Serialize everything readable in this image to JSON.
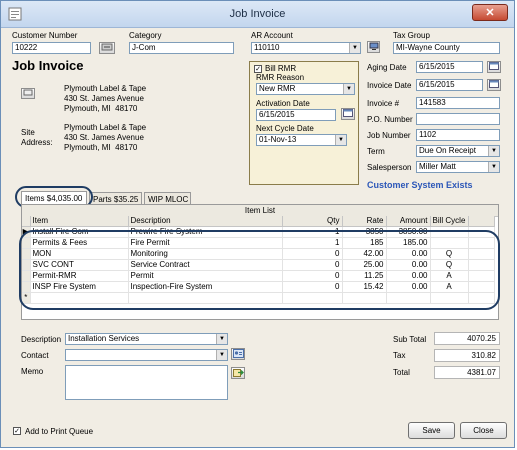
{
  "window": {
    "title": "Job Invoice"
  },
  "top": {
    "customer_number_label": "Customer Number",
    "customer_number": "10222",
    "category_label": "Category",
    "category": "J-Com",
    "ar_account_label": "AR Account",
    "ar_account": "110110",
    "tax_group_label": "Tax Group",
    "tax_group": "MI-Wayne County"
  },
  "heading": "Job Invoice",
  "bill_to": {
    "name": "Plymouth Label & Tape",
    "street": "430 St. James Avenue",
    "city": "Plymouth, MI  48170"
  },
  "site": {
    "label": "Site Address:",
    "name": "Plymouth Label & Tape",
    "street": "430 St. James Avenue",
    "city": "Plymouth, MI  48170"
  },
  "rmr": {
    "bill_rmr_label": "Bill RMR",
    "bill_rmr_checked": true,
    "reason_label": "RMR Reason",
    "reason": "New RMR",
    "activation_label": "Activation Date",
    "activation": "6/15/2015",
    "next_cycle_label": "Next Cycle Date",
    "next_cycle": "01-Nov-13"
  },
  "invoice": {
    "aging_label": "Aging Date",
    "aging": "6/15/2015",
    "invoice_date_label": "Invoice Date",
    "invoice_date": "6/15/2015",
    "invoice_no_label": "Invoice #",
    "invoice_no": "141583",
    "po_label": "P.O. Number",
    "po": "",
    "job_label": "Job Number",
    "job": "1102",
    "term_label": "Term",
    "term": "Due On Receipt",
    "salesperson_label": "Salesperson",
    "salesperson": "Miller Matt"
  },
  "customer_system_link": "Customer System Exists",
  "tabs": [
    {
      "label": "Items  $4,035.00"
    },
    {
      "label": "Parts  $35.25"
    },
    {
      "label": "WIP MLOC"
    }
  ],
  "grid": {
    "caption": "Item List",
    "columns": [
      "Item",
      "Description",
      "Qty",
      "Rate",
      "Amount",
      "Bill Cycle"
    ],
    "rows": [
      [
        "Install Fire Com",
        "Prewire Fire System",
        "1",
        "3850",
        "3850.00",
        ""
      ],
      [
        "Permits & Fees",
        "Fire Permit",
        "1",
        "185",
        "185.00",
        ""
      ],
      [
        "MON",
        "Monitoring",
        "0",
        "42.00",
        "0.00",
        "Q"
      ],
      [
        "SVC CONT",
        "Service Contract",
        "0",
        "25.00",
        "0.00",
        "Q"
      ],
      [
        "Permit-RMR",
        "Permit",
        "0",
        "11.25",
        "0.00",
        "A"
      ],
      [
        "INSP Fire System",
        "Inspection-Fire System",
        "0",
        "15.42",
        "0.00",
        "A"
      ],
      [
        "",
        "",
        "",
        "",
        "",
        ""
      ]
    ],
    "new_row_marker": "*",
    "current_row_marker": "▶"
  },
  "bottom": {
    "description_label": "Description",
    "description": "Installation Services",
    "contact_label": "Contact",
    "contact": "",
    "memo_label": "Memo",
    "subtotal_label": "Sub Total",
    "subtotal": "4070.25",
    "tax_label": "Tax",
    "tax": "310.82",
    "total_label": "Total",
    "total": "4381.07",
    "print_queue_label": "Add to Print Queue",
    "print_queue_checked": true,
    "save_label": "Save",
    "close_label": "Close"
  },
  "icons": {
    "close": "close-icon",
    "calendar": "calendar-icon",
    "dropdown": "chevron-down-icon",
    "search": "search-icon",
    "map": "map-icon",
    "contact_card": "contact-card-icon",
    "memo_add": "memo-add-icon"
  }
}
